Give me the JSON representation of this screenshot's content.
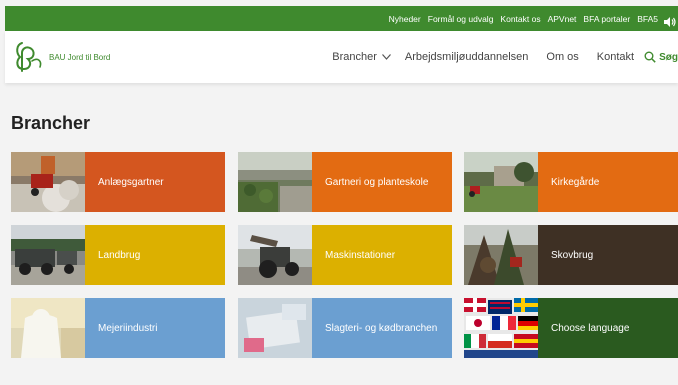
{
  "topbar": {
    "links": [
      "Nyheder",
      "Formål og udvalg",
      "Kontakt os",
      "APVnet",
      "BFA portaler",
      "BFA5"
    ]
  },
  "header": {
    "logo_text": "BAU Jord til Bord",
    "nav": {
      "brancher": "Brancher",
      "arbejdsmiljo": "Arbejdsmiljøuddannelsen",
      "om_os": "Om os",
      "kontakt": "Kontakt",
      "search": "Søg"
    }
  },
  "page_title": "Brancher",
  "tiles": [
    {
      "label": "Anlægsgartner",
      "color": "#d4561f"
    },
    {
      "label": "Gartneri og planteskole",
      "color": "#e36b12"
    },
    {
      "label": "Kirkegårde",
      "color": "#e36b12"
    },
    {
      "label": "Landbrug",
      "color": "#dcb000"
    },
    {
      "label": "Maskinstationer",
      "color": "#dcb000"
    },
    {
      "label": "Skovbrug",
      "color": "#3e3024"
    },
    {
      "label": "Mejeriindustri",
      "color": "#6b9fd1"
    },
    {
      "label": "Slagteri- og kødbranchen",
      "color": "#6b9fd1"
    },
    {
      "label": "Choose language",
      "color": "#2a5a1f"
    }
  ],
  "colors": {
    "brand_green": "#3f8a2e",
    "background": "#f3f3f3"
  }
}
